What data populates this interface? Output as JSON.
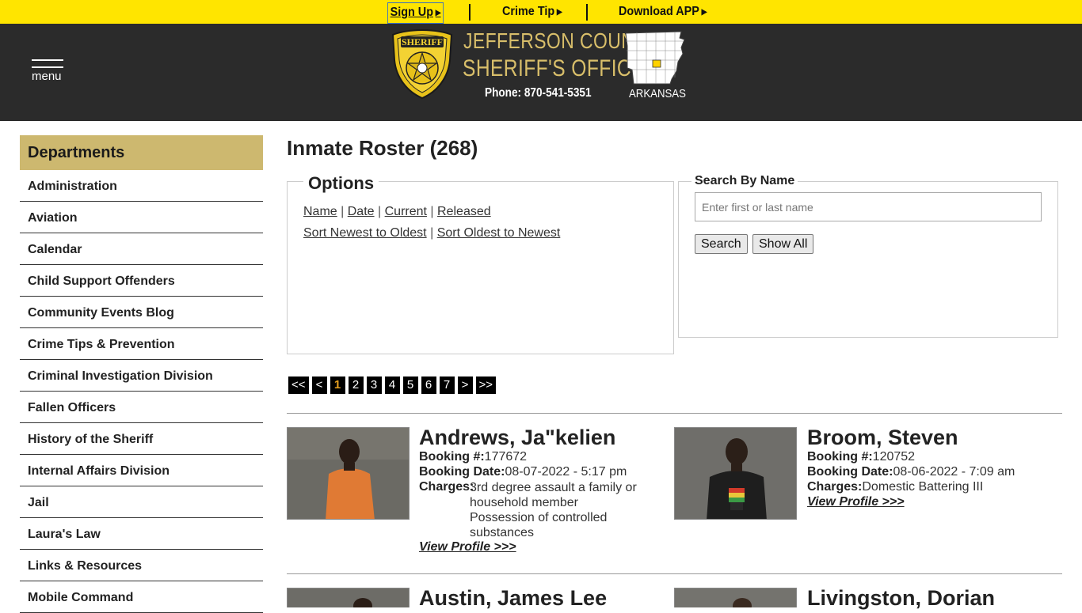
{
  "topbar": {
    "signup": "Sign Up",
    "crime_tip": "Crime Tip",
    "download_app": "Download APP"
  },
  "header": {
    "menu_label": "menu",
    "title_line1": "JEFFERSON COUNTY",
    "title_line2": "SHERIFF'S OFFICE",
    "phone": "Phone: 870-541-5351",
    "state": "ARKANSAS",
    "badge_lettering": "SHERIFF JEFFERSON COUNTY ARKANSAS"
  },
  "sidebar": {
    "heading": "Departments",
    "items": [
      "Administration",
      "Aviation",
      "Calendar",
      "Child Support Offenders",
      "Community Events Blog",
      "Crime Tips & Prevention",
      "Criminal Investigation Division",
      "Fallen Officers",
      "History of the Sheriff",
      "Internal Affairs Division",
      "Jail",
      "Laura's Law",
      "Links & Resources",
      "Mobile Command"
    ]
  },
  "main": {
    "title": "Inmate Roster (268)",
    "options": {
      "legend": "Options",
      "filters": [
        "Name",
        "Date",
        "Current",
        "Released"
      ],
      "sorts": [
        "Sort Newest to Oldest",
        "Sort Oldest to Newest"
      ],
      "sep": "|"
    },
    "search": {
      "legend": "Search By Name",
      "placeholder": "Enter first or last name",
      "search_btn": "Search",
      "show_all_btn": "Show All"
    },
    "pager": [
      "<<",
      "<",
      "1",
      "2",
      "3",
      "4",
      "5",
      "6",
      "7",
      ">",
      ">>"
    ],
    "pager_active": "1",
    "labels": {
      "booking_no": "Booking #:",
      "booking_date": "Booking Date:",
      "charges": "Charges:",
      "view_profile": "View Profile >>>"
    },
    "inmates": [
      {
        "name": "Andrews, Ja\"kelien",
        "booking_no": "177672",
        "booking_date": "08-07-2022 - 5:17 pm",
        "charges": [
          "3rd degree assault a family or household member",
          "Possession of controlled substances"
        ]
      },
      {
        "name": "Broom, Steven",
        "booking_no": "120752",
        "booking_date": "08-06-2022 - 7:09 am",
        "charges": [
          "Domestic Battering III"
        ]
      },
      {
        "name": "Austin, James Lee"
      },
      {
        "name": "Livingston, Dorian"
      }
    ]
  },
  "colors": {
    "topbar_bg": "#ffe500",
    "header_bg": "#2b2b2b",
    "title_gold": "#d8be6a",
    "sidebar_head_bg": "#cdb86f",
    "pager_bg": "#000000",
    "pager_active": "#e6a020"
  }
}
